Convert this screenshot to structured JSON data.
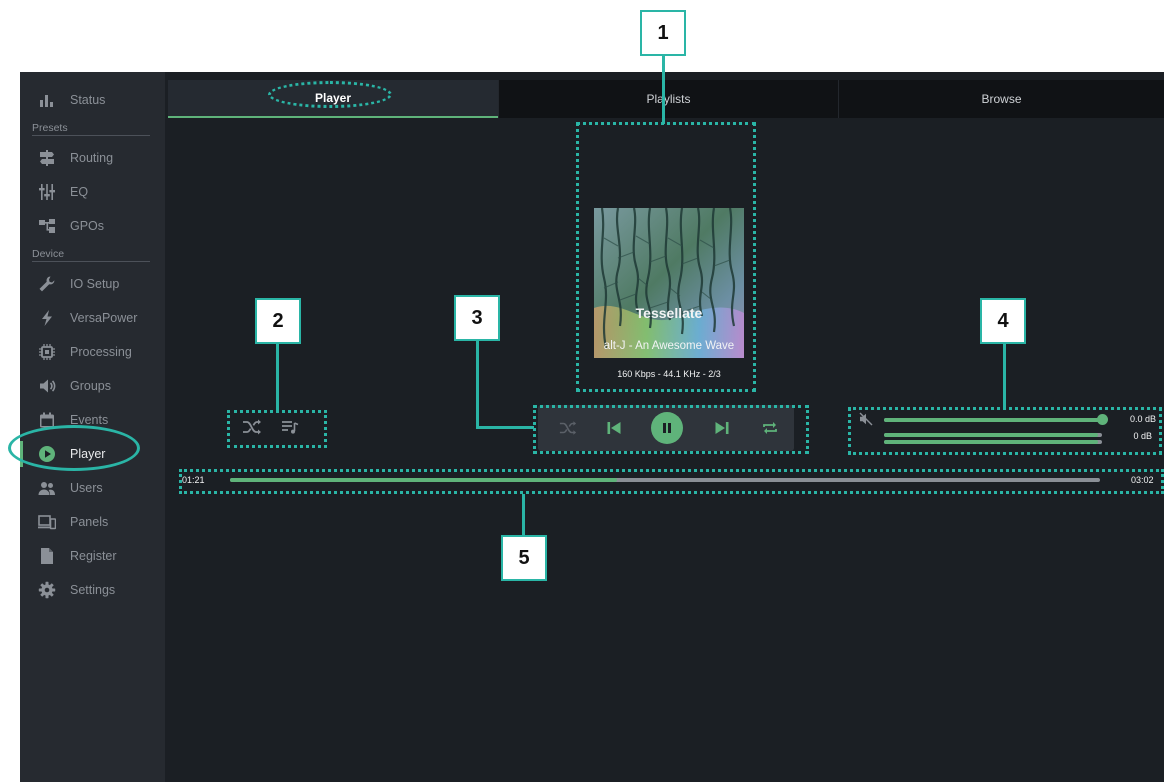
{
  "sidebar": {
    "sections": {
      "presets": "Presets",
      "device": "Device"
    },
    "items": [
      {
        "label": "Status",
        "icon": "bar-chart-icon"
      },
      {
        "label": "Routing",
        "icon": "signpost-icon"
      },
      {
        "label": "EQ",
        "icon": "sliders-icon"
      },
      {
        "label": "GPOs",
        "icon": "network-icon"
      },
      {
        "label": "IO Setup",
        "icon": "wrench-icon"
      },
      {
        "label": "VersaPower",
        "icon": "lightning-icon"
      },
      {
        "label": "Processing",
        "icon": "chip-icon"
      },
      {
        "label": "Groups",
        "icon": "speaker-icon"
      },
      {
        "label": "Events",
        "icon": "calendar-icon"
      },
      {
        "label": "Player",
        "icon": "play-circle-icon",
        "active": true
      },
      {
        "label": "Users",
        "icon": "users-icon"
      },
      {
        "label": "Panels",
        "icon": "devices-icon"
      },
      {
        "label": "Register",
        "icon": "document-icon"
      },
      {
        "label": "Settings",
        "icon": "gear-icon"
      }
    ]
  },
  "tabs": [
    {
      "label": "Player",
      "active": true
    },
    {
      "label": "Playlists"
    },
    {
      "label": "Browse"
    }
  ],
  "now_playing": {
    "title": "Tessellate",
    "artist_album": "alt-J - An Awesome Wave",
    "meta": "160 Kbps - 44.1 KHz - 2/3"
  },
  "quick_controls": {
    "shuffle_icon": "shuffle-icon",
    "queue_icon": "queue-music-icon"
  },
  "transport": {
    "shuffle_icon": "shuffle-icon",
    "previous_icon": "skip-previous-icon",
    "play_pause_icon": "pause-icon",
    "next_icon": "skip-next-icon",
    "repeat_icon": "repeat-icon"
  },
  "volume": {
    "mute_icon": "volume-mute-icon",
    "master_db": "0.0 dB",
    "master_level": 1.0,
    "meter_db": "0 dB",
    "meter_levels": [
      0.98,
      0.98
    ]
  },
  "progress": {
    "elapsed": "01:21",
    "total": "03:02",
    "fraction": 0.445
  },
  "callouts": [
    "1",
    "2",
    "3",
    "4",
    "5"
  ],
  "colors": {
    "accent": "#5fb37a",
    "annotation": "#2ab5a6",
    "background": "#1b1f24",
    "sidebar": "#262a30"
  }
}
